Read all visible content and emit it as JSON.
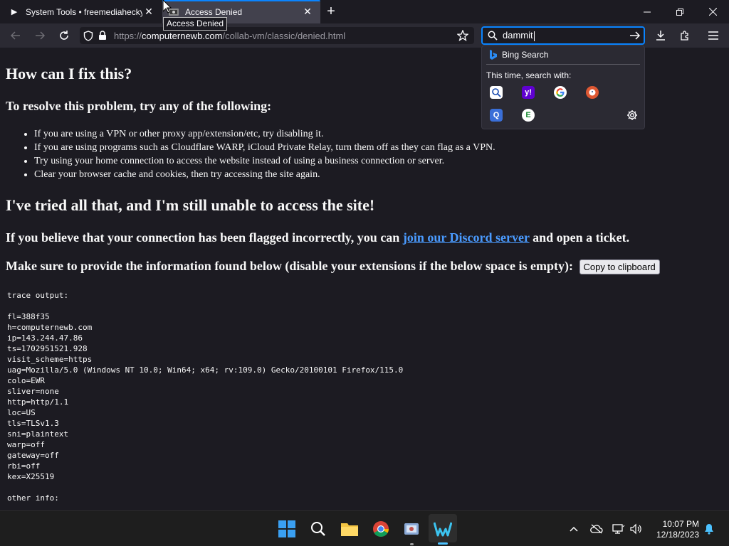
{
  "browser": {
    "tabs": [
      {
        "label": "System Tools • freemediaheckyeah"
      },
      {
        "label": "Access Denied"
      }
    ],
    "tooltip": "Access Denied",
    "url": {
      "scheme": "https://",
      "host": "computernewb.com",
      "path": "/collab-vm/classic/denied.html"
    },
    "search": {
      "value": "dammit",
      "suggestion": "Bing Search",
      "hint": "This time, search with:"
    }
  },
  "page": {
    "heading_fix": "How can I fix this?",
    "subheading_resolve": "To resolve this problem, try any of the following:",
    "bullets": [
      "If you are using a VPN or other proxy app/extension/etc, try disabling it.",
      "If you are using programs such as Cloudflare WARP, iCloud Private Relay, turn them off as they can flag as a VPN.",
      "Try using your home connection to access the website instead of using a business connection or server.",
      "Clear your browser cache and cookies, then try accessing the site again."
    ],
    "heading_tried": "I've tried all that, and I'm still unable to access the site!",
    "flagged_prefix": "If you believe that your connection has been flagged incorrectly, you can ",
    "flagged_link": "join our Discord server",
    "flagged_suffix": " and open a ticket.",
    "provide_info": "Make sure to provide the information found below (disable your extensions if the below space is empty):",
    "copy_button": "Copy to clipboard",
    "trace_text": "trace output:\n\nfl=388f35\nh=computernewb.com\nip=143.244.47.86\nts=1702951521.928\nvisit_scheme=https\nuag=Mozilla/5.0 (Windows NT 10.0; Win64; x64; rv:109.0) Gecko/20100101 Firefox/115.0\ncolo=EWR\nsliver=none\nhttp=http/1.1\nloc=US\ntls=TLSv1.3\nsni=plaintext\nwarp=off\ngateway=off\nrbi=off\nkex=X25519\n\nother info:"
  },
  "taskbar": {
    "time": "10:07 PM",
    "date": "12/18/2023"
  },
  "colors": {
    "accent": "#0a84ff",
    "link": "#4a9bff",
    "page_bg": "#1c1b22"
  }
}
